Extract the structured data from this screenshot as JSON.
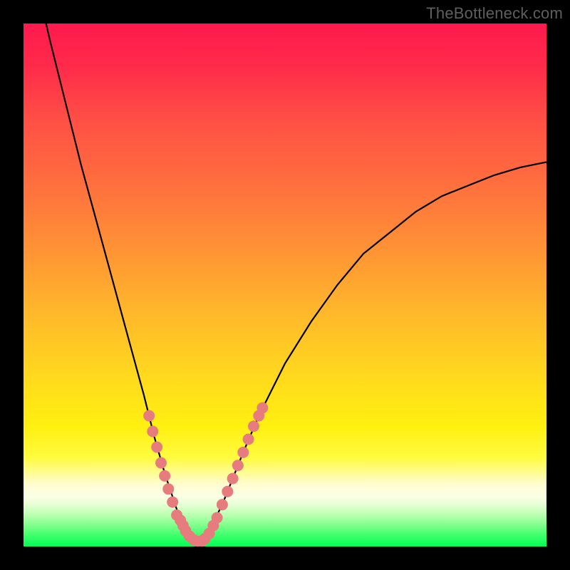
{
  "watermark": "TheBottleneck.com",
  "colors": {
    "frame": "#000000",
    "curve": "#000000",
    "marker": "#e77c7e",
    "gradient_top": "#ff1a4d",
    "gradient_bottom": "#00ff55"
  },
  "chart_data": {
    "type": "line",
    "title": "",
    "xlabel": "",
    "ylabel": "",
    "xlim": [
      0,
      100
    ],
    "ylim": [
      0,
      100
    ],
    "grid": false,
    "legend": false,
    "description": "V-shaped bottleneck curve on a vertical rainbow background (red high, green low). Curve minimum is near zero at the notch; y rises asymmetrically on both sides. Salmon-colored markers cluster around the trough.",
    "series": [
      {
        "name": "bottleneck-curve",
        "x": [
          0,
          2,
          5,
          8,
          11,
          14,
          17,
          20,
          23,
          25,
          27,
          29,
          30,
          31,
          32,
          33,
          34,
          35,
          36,
          38,
          40,
          42,
          45,
          50,
          55,
          60,
          65,
          70,
          75,
          80,
          85,
          90,
          95,
          100
        ],
        "y": [
          120,
          110,
          97,
          85,
          73,
          62,
          51,
          40,
          29,
          21,
          14,
          8,
          5,
          3,
          2,
          1,
          1,
          2,
          4,
          8,
          13,
          18,
          25,
          35,
          43,
          50,
          56,
          60,
          64,
          67,
          69,
          71,
          72.5,
          73.5
        ]
      }
    ],
    "markers": [
      {
        "x": 24.0,
        "y": 25.0
      },
      {
        "x": 24.7,
        "y": 22.0
      },
      {
        "x": 25.5,
        "y": 19.0
      },
      {
        "x": 26.3,
        "y": 16.0
      },
      {
        "x": 27.0,
        "y": 13.5
      },
      {
        "x": 27.7,
        "y": 11.0
      },
      {
        "x": 28.5,
        "y": 8.5
      },
      {
        "x": 29.3,
        "y": 6.0
      },
      {
        "x": 30.0,
        "y": 5.0
      },
      {
        "x": 30.5,
        "y": 4.0
      },
      {
        "x": 31.0,
        "y": 3.0
      },
      {
        "x": 31.7,
        "y": 2.0
      },
      {
        "x": 32.5,
        "y": 1.3
      },
      {
        "x": 33.3,
        "y": 1.0
      },
      {
        "x": 34.0,
        "y": 1.0
      },
      {
        "x": 34.7,
        "y": 1.5
      },
      {
        "x": 35.5,
        "y": 2.5
      },
      {
        "x": 36.3,
        "y": 4.0
      },
      {
        "x": 37.0,
        "y": 5.5
      },
      {
        "x": 38.0,
        "y": 8.0
      },
      {
        "x": 39.0,
        "y": 10.5
      },
      {
        "x": 40.0,
        "y": 13.0
      },
      {
        "x": 41.0,
        "y": 15.5
      },
      {
        "x": 42.0,
        "y": 18.0
      },
      {
        "x": 43.0,
        "y": 20.5
      },
      {
        "x": 44.0,
        "y": 23.0
      },
      {
        "x": 45.0,
        "y": 25.0
      },
      {
        "x": 45.7,
        "y": 26.5
      }
    ]
  }
}
